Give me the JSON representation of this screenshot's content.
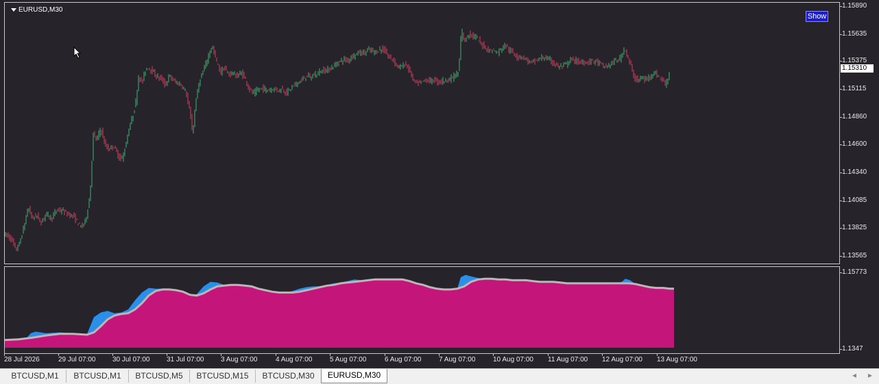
{
  "chart": {
    "symbol_title": "EURUSD,M30",
    "show_button": "Show",
    "current_price": "1.15310",
    "price_axis": [
      "1.15890",
      "1.15635",
      "1.15375",
      "1.15115",
      "1.14860",
      "1.14600",
      "1.14340",
      "1.14085",
      "1.13825",
      "1.13565"
    ],
    "indicator_axis": [
      "1.15773",
      "1.1347"
    ],
    "time_axis": [
      "28 Jul 2026",
      "29 Jul 07:00",
      "30 Jul 07:00",
      "31 Jul 07:00",
      "3 Aug 07:00",
      "4 Aug 07:00",
      "5 Aug 07:00",
      "6 Aug 07:00",
      "7 Aug 07:00",
      "10 Aug 07:00",
      "11 Aug 07:00",
      "12 Aug 07:00",
      "13 Aug 07:00"
    ],
    "colors": {
      "background": "#27232b",
      "bull_candle": "#3cb371",
      "bear_candle": "#d43f5e",
      "indicator_fill": "#c4157a",
      "indicator_cloud": "#2b8fe8",
      "indicator_line": "#b8b8b8"
    }
  },
  "chart_data": {
    "type": "line",
    "series": [
      {
        "name": "EURUSD,M30",
        "x": [
          "28 Jul 2026",
          "29 Jul 07:00",
          "30 Jul 07:00",
          "31 Jul 07:00",
          "3 Aug 07:00",
          "4 Aug 07:00",
          "5 Aug 07:00",
          "6 Aug 07:00",
          "7 Aug 07:00",
          "10 Aug 07:00",
          "11 Aug 07:00",
          "12 Aug 07:00",
          "13 Aug 07:00"
        ],
        "values": [
          1.1375,
          1.1395,
          1.1435,
          1.153,
          1.1545,
          1.151,
          1.1535,
          1.1555,
          1.1525,
          1.1555,
          1.154,
          1.154,
          1.153
        ]
      }
    ],
    "price_path": [
      [
        0,
        1.1378
      ],
      [
        6,
        1.1376
      ],
      [
        12,
        1.1372
      ],
      [
        18,
        1.1362
      ],
      [
        24,
        1.137
      ],
      [
        30,
        1.1385
      ],
      [
        36,
        1.1402
      ],
      [
        42,
        1.1392
      ],
      [
        48,
        1.1395
      ],
      [
        55,
        1.1388
      ],
      [
        62,
        1.1397
      ],
      [
        70,
        1.1392
      ],
      [
        78,
        1.14
      ],
      [
        86,
        1.1399
      ],
      [
        94,
        1.1396
      ],
      [
        102,
        1.1394
      ],
      [
        108,
        1.1388
      ],
      [
        114,
        1.1384
      ],
      [
        120,
        1.1391
      ],
      [
        126,
        1.1412
      ],
      [
        131,
        1.147
      ],
      [
        136,
        1.1465
      ],
      [
        142,
        1.1476
      ],
      [
        148,
        1.146
      ],
      [
        154,
        1.1456
      ],
      [
        160,
        1.146
      ],
      [
        166,
        1.1452
      ],
      [
        172,
        1.1446
      ],
      [
        178,
        1.1459
      ],
      [
        183,
        1.1475
      ],
      [
        188,
        1.1486
      ],
      [
        193,
        1.15
      ],
      [
        197,
        1.1525
      ],
      [
        202,
        1.1518
      ],
      [
        207,
        1.153
      ],
      [
        212,
        1.1533
      ],
      [
        218,
        1.1528
      ],
      [
        224,
        1.1524
      ],
      [
        230,
        1.1522
      ],
      [
        236,
        1.1516
      ],
      [
        242,
        1.1525
      ],
      [
        248,
        1.152
      ],
      [
        254,
        1.1518
      ],
      [
        260,
        1.1516
      ],
      [
        266,
        1.151
      ],
      [
        272,
        1.149
      ],
      [
        276,
        1.147
      ],
      [
        280,
        1.15
      ],
      [
        286,
        1.152
      ],
      [
        292,
        1.153
      ],
      [
        298,
        1.1542
      ],
      [
        304,
        1.1553
      ],
      [
        310,
        1.154
      ],
      [
        316,
        1.1528
      ],
      [
        322,
        1.1532
      ],
      [
        328,
        1.1526
      ],
      [
        334,
        1.1528
      ],
      [
        340,
        1.1524
      ],
      [
        346,
        1.1528
      ],
      [
        352,
        1.1523
      ],
      [
        358,
        1.1513
      ],
      [
        364,
        1.1508
      ],
      [
        370,
        1.1511
      ],
      [
        376,
        1.1513
      ],
      [
        382,
        1.1512
      ],
      [
        388,
        1.1512
      ],
      [
        394,
        1.1513
      ],
      [
        400,
        1.1511
      ],
      [
        406,
        1.1513
      ],
      [
        412,
        1.1509
      ],
      [
        418,
        1.1512
      ],
      [
        424,
        1.1516
      ],
      [
        430,
        1.1519
      ],
      [
        436,
        1.1521
      ],
      [
        442,
        1.1525
      ],
      [
        448,
        1.1523
      ],
      [
        454,
        1.1526
      ],
      [
        460,
        1.1528
      ],
      [
        466,
        1.153
      ],
      [
        472,
        1.153
      ],
      [
        478,
        1.1532
      ],
      [
        484,
        1.1535
      ],
      [
        490,
        1.1538
      ],
      [
        496,
        1.154
      ],
      [
        502,
        1.1539
      ],
      [
        508,
        1.1543
      ],
      [
        514,
        1.1545
      ],
      [
        520,
        1.1547
      ],
      [
        526,
        1.1546
      ],
      [
        532,
        1.1549
      ],
      [
        538,
        1.1548
      ],
      [
        544,
        1.1547
      ],
      [
        550,
        1.155
      ],
      [
        556,
        1.1548
      ],
      [
        562,
        1.1542
      ],
      [
        568,
        1.154
      ],
      [
        574,
        1.1534
      ],
      [
        580,
        1.1533
      ],
      [
        586,
        1.1536
      ],
      [
        592,
        1.153
      ],
      [
        598,
        1.152
      ],
      [
        604,
        1.1517
      ],
      [
        610,
        1.1519
      ],
      [
        616,
        1.1521
      ],
      [
        622,
        1.152
      ],
      [
        628,
        1.1521
      ],
      [
        634,
        1.1519
      ],
      [
        640,
        1.152
      ],
      [
        646,
        1.1521
      ],
      [
        652,
        1.1522
      ],
      [
        658,
        1.1525
      ],
      [
        664,
        1.1528
      ],
      [
        668,
        1.157
      ],
      [
        672,
        1.1556
      ],
      [
        678,
        1.1564
      ],
      [
        684,
        1.1562
      ],
      [
        690,
        1.156
      ],
      [
        696,
        1.1555
      ],
      [
        702,
        1.1552
      ],
      [
        708,
        1.1548
      ],
      [
        714,
        1.1549
      ],
      [
        720,
        1.1546
      ],
      [
        726,
        1.155
      ],
      [
        732,
        1.1554
      ],
      [
        738,
        1.1548
      ],
      [
        744,
        1.1546
      ],
      [
        750,
        1.1542
      ],
      [
        756,
        1.1543
      ],
      [
        762,
        1.154
      ],
      [
        768,
        1.1537
      ],
      [
        774,
        1.1538
      ],
      [
        780,
        1.154
      ],
      [
        786,
        1.1542
      ],
      [
        792,
        1.1541
      ],
      [
        798,
        1.1539
      ],
      [
        804,
        1.1536
      ],
      [
        810,
        1.1533
      ],
      [
        816,
        1.1534
      ],
      [
        822,
        1.1536
      ],
      [
        828,
        1.154
      ],
      [
        834,
        1.1539
      ],
      [
        840,
        1.1537
      ],
      [
        846,
        1.1538
      ],
      [
        852,
        1.1537
      ],
      [
        858,
        1.1539
      ],
      [
        864,
        1.1538
      ],
      [
        870,
        1.1536
      ],
      [
        876,
        1.1533
      ],
      [
        882,
        1.1534
      ],
      [
        888,
        1.1537
      ],
      [
        894,
        1.1539
      ],
      [
        900,
        1.1541
      ],
      [
        906,
        1.1552
      ],
      [
        910,
        1.1542
      ],
      [
        914,
        1.1536
      ],
      [
        918,
        1.1526
      ],
      [
        924,
        1.152
      ],
      [
        930,
        1.1523
      ],
      [
        936,
        1.1521
      ],
      [
        942,
        1.1524
      ],
      [
        948,
        1.1528
      ],
      [
        954,
        1.1525
      ],
      [
        960,
        1.1522
      ],
      [
        966,
        1.1516
      ],
      [
        970,
        1.1526
      ],
      [
        976,
        1.1533
      ]
    ],
    "indicator_line": [
      [
        0,
        0.1
      ],
      [
        20,
        0.11
      ],
      [
        40,
        0.13
      ],
      [
        60,
        0.16
      ],
      [
        80,
        0.18
      ],
      [
        100,
        0.18
      ],
      [
        120,
        0.17
      ],
      [
        130,
        0.2
      ],
      [
        140,
        0.28
      ],
      [
        150,
        0.37
      ],
      [
        160,
        0.42
      ],
      [
        170,
        0.44
      ],
      [
        180,
        0.45
      ],
      [
        190,
        0.5
      ],
      [
        200,
        0.58
      ],
      [
        210,
        0.68
      ],
      [
        220,
        0.74
      ],
      [
        230,
        0.76
      ],
      [
        240,
        0.76
      ],
      [
        250,
        0.75
      ],
      [
        260,
        0.73
      ],
      [
        270,
        0.69
      ],
      [
        280,
        0.68
      ],
      [
        290,
        0.71
      ],
      [
        300,
        0.76
      ],
      [
        310,
        0.8
      ],
      [
        320,
        0.81
      ],
      [
        330,
        0.82
      ],
      [
        340,
        0.82
      ],
      [
        350,
        0.81
      ],
      [
        360,
        0.8
      ],
      [
        370,
        0.77
      ],
      [
        380,
        0.75
      ],
      [
        390,
        0.73
      ],
      [
        400,
        0.72
      ],
      [
        410,
        0.72
      ],
      [
        420,
        0.72
      ],
      [
        430,
        0.73
      ],
      [
        440,
        0.75
      ],
      [
        450,
        0.77
      ],
      [
        460,
        0.79
      ],
      [
        470,
        0.81
      ],
      [
        480,
        0.82
      ],
      [
        490,
        0.84
      ],
      [
        500,
        0.85
      ],
      [
        510,
        0.86
      ],
      [
        520,
        0.87
      ],
      [
        530,
        0.88
      ],
      [
        540,
        0.89
      ],
      [
        550,
        0.89
      ],
      [
        560,
        0.89
      ],
      [
        570,
        0.89
      ],
      [
        580,
        0.89
      ],
      [
        590,
        0.87
      ],
      [
        600,
        0.84
      ],
      [
        610,
        0.82
      ],
      [
        620,
        0.79
      ],
      [
        630,
        0.77
      ],
      [
        640,
        0.76
      ],
      [
        650,
        0.76
      ],
      [
        660,
        0.77
      ],
      [
        670,
        0.8
      ],
      [
        680,
        0.86
      ],
      [
        690,
        0.89
      ],
      [
        700,
        0.9
      ],
      [
        710,
        0.9
      ],
      [
        720,
        0.89
      ],
      [
        730,
        0.89
      ],
      [
        740,
        0.88
      ],
      [
        750,
        0.88
      ],
      [
        760,
        0.88
      ],
      [
        770,
        0.87
      ],
      [
        780,
        0.86
      ],
      [
        790,
        0.86
      ],
      [
        800,
        0.86
      ],
      [
        810,
        0.85
      ],
      [
        820,
        0.84
      ],
      [
        830,
        0.84
      ],
      [
        840,
        0.84
      ],
      [
        850,
        0.84
      ],
      [
        860,
        0.84
      ],
      [
        870,
        0.84
      ],
      [
        880,
        0.84
      ],
      [
        890,
        0.84
      ],
      [
        900,
        0.84
      ],
      [
        910,
        0.84
      ],
      [
        920,
        0.83
      ],
      [
        930,
        0.81
      ],
      [
        940,
        0.79
      ],
      [
        950,
        0.78
      ],
      [
        960,
        0.78
      ],
      [
        970,
        0.77
      ],
      [
        976,
        0.77
      ]
    ],
    "indicator_cloud": [
      [
        0,
        0.1
      ],
      [
        30,
        0.11
      ],
      [
        38,
        0.19
      ],
      [
        45,
        0.21
      ],
      [
        60,
        0.19
      ],
      [
        80,
        0.2
      ],
      [
        100,
        0.19
      ],
      [
        120,
        0.18
      ],
      [
        130,
        0.4
      ],
      [
        140,
        0.46
      ],
      [
        150,
        0.48
      ],
      [
        160,
        0.45
      ],
      [
        170,
        0.46
      ],
      [
        180,
        0.5
      ],
      [
        190,
        0.62
      ],
      [
        200,
        0.72
      ],
      [
        210,
        0.78
      ],
      [
        220,
        0.77
      ],
      [
        230,
        0.77
      ],
      [
        240,
        0.76
      ],
      [
        250,
        0.75
      ],
      [
        260,
        0.73
      ],
      [
        270,
        0.69
      ],
      [
        280,
        0.7
      ],
      [
        290,
        0.8
      ],
      [
        300,
        0.86
      ],
      [
        310,
        0.85
      ],
      [
        320,
        0.82
      ],
      [
        330,
        0.82
      ],
      [
        340,
        0.82
      ],
      [
        350,
        0.81
      ],
      [
        360,
        0.8
      ],
      [
        370,
        0.77
      ],
      [
        380,
        0.75
      ],
      [
        390,
        0.73
      ],
      [
        400,
        0.72
      ],
      [
        410,
        0.72
      ],
      [
        420,
        0.74
      ],
      [
        430,
        0.77
      ],
      [
        440,
        0.79
      ],
      [
        450,
        0.8
      ],
      [
        460,
        0.8
      ],
      [
        470,
        0.82
      ],
      [
        480,
        0.84
      ],
      [
        490,
        0.85
      ],
      [
        500,
        0.87
      ],
      [
        510,
        0.89
      ],
      [
        520,
        0.88
      ],
      [
        530,
        0.89
      ],
      [
        540,
        0.9
      ],
      [
        550,
        0.9
      ],
      [
        560,
        0.89
      ],
      [
        570,
        0.89
      ],
      [
        580,
        0.89
      ],
      [
        590,
        0.87
      ],
      [
        600,
        0.84
      ],
      [
        610,
        0.82
      ],
      [
        620,
        0.79
      ],
      [
        630,
        0.77
      ],
      [
        640,
        0.76
      ],
      [
        650,
        0.76
      ],
      [
        660,
        0.77
      ],
      [
        665,
        0.92
      ],
      [
        672,
        0.95
      ],
      [
        680,
        0.93
      ],
      [
        690,
        0.91
      ],
      [
        700,
        0.9
      ],
      [
        710,
        0.9
      ],
      [
        720,
        0.89
      ],
      [
        730,
        0.9
      ],
      [
        740,
        0.88
      ],
      [
        750,
        0.88
      ],
      [
        760,
        0.88
      ],
      [
        770,
        0.87
      ],
      [
        780,
        0.86
      ],
      [
        790,
        0.86
      ],
      [
        800,
        0.86
      ],
      [
        810,
        0.85
      ],
      [
        820,
        0.84
      ],
      [
        830,
        0.84
      ],
      [
        840,
        0.84
      ],
      [
        850,
        0.84
      ],
      [
        860,
        0.84
      ],
      [
        870,
        0.84
      ],
      [
        880,
        0.84
      ],
      [
        890,
        0.84
      ],
      [
        900,
        0.86
      ],
      [
        905,
        0.9
      ],
      [
        912,
        0.88
      ],
      [
        920,
        0.83
      ],
      [
        930,
        0.81
      ],
      [
        940,
        0.79
      ],
      [
        950,
        0.78
      ],
      [
        960,
        0.78
      ],
      [
        970,
        0.77
      ],
      [
        976,
        0.77
      ]
    ],
    "ylim": [
      1.1347,
      1.1589
    ],
    "indicator_ylim": [
      1.1347,
      1.15773
    ]
  },
  "tabs": [
    "BTCUSD,M1",
    "BTCUSD,M1",
    "BTCUSD,M5",
    "BTCUSD,M15",
    "BTCUSD,M30",
    "EURUSD,M30"
  ],
  "active_tab": "EURUSD,M30"
}
